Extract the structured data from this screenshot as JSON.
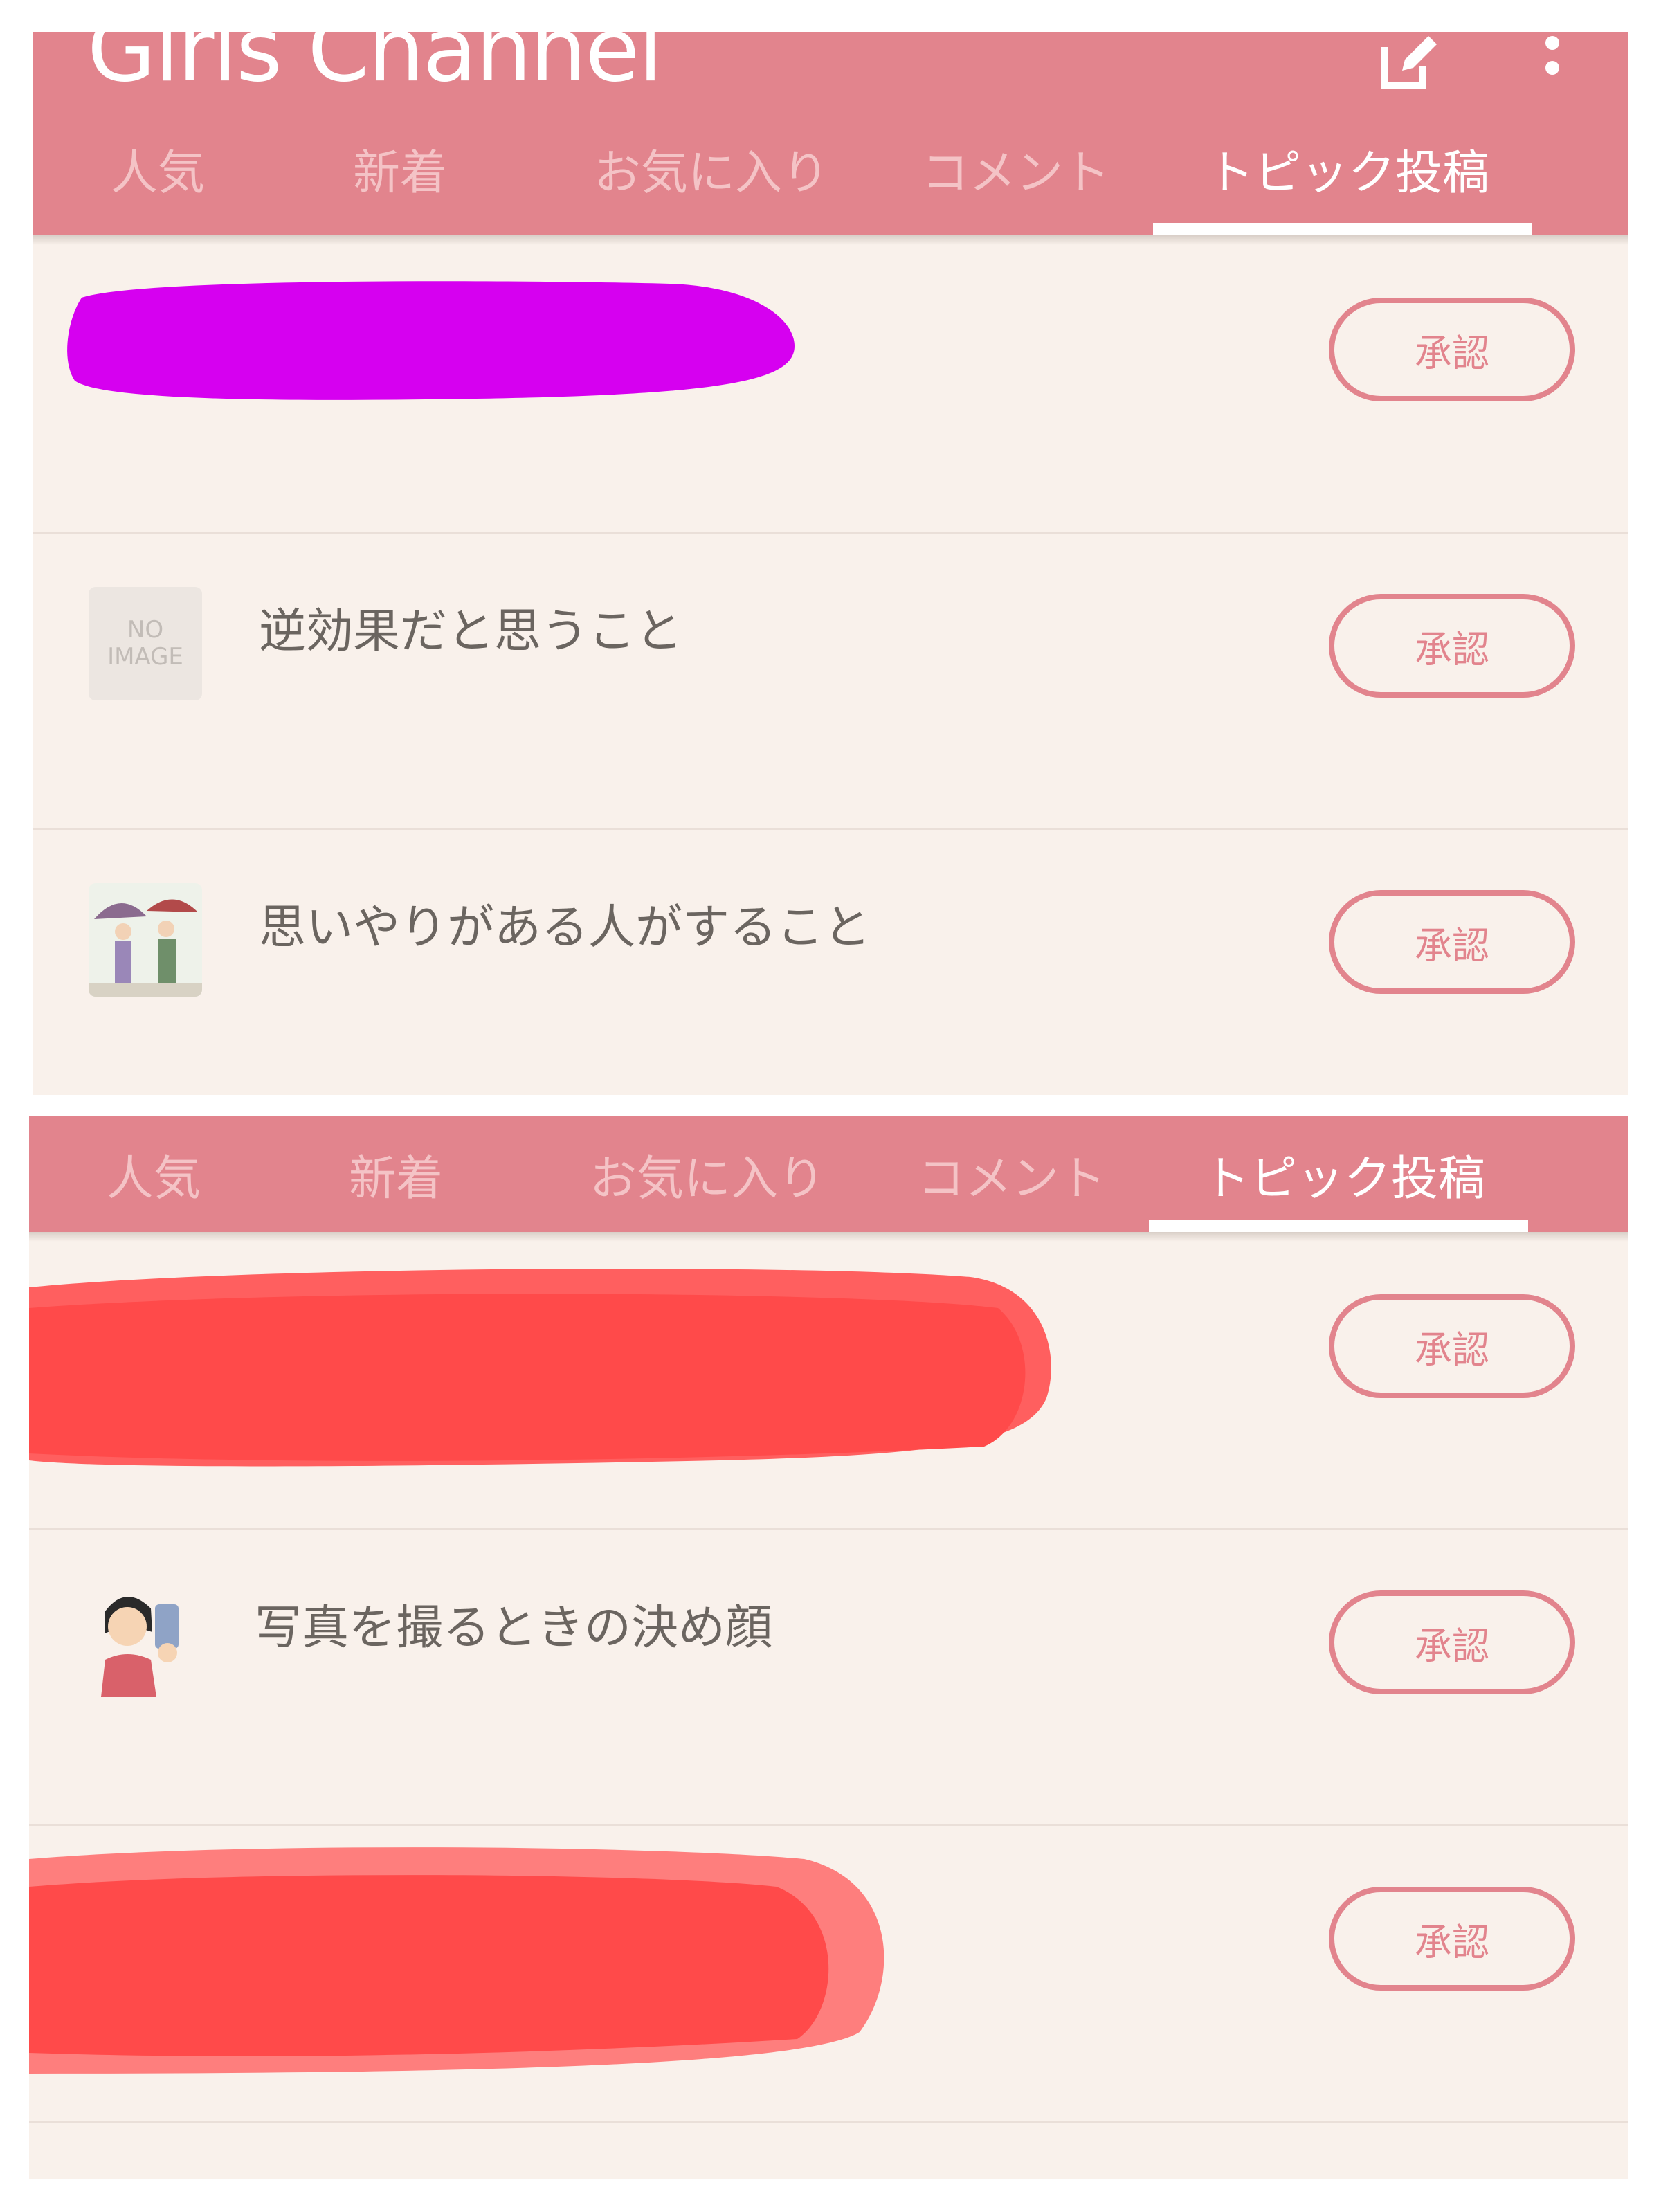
{
  "app": {
    "title": "Girls Channel"
  },
  "icons": {
    "compose": "compose-icon",
    "more": "more-vert-icon"
  },
  "tabs": [
    {
      "label": "人気",
      "active": false
    },
    {
      "label": "新着",
      "active": false
    },
    {
      "label": "お気に入り",
      "active": false
    },
    {
      "label": "コメント",
      "active": false
    },
    {
      "label": "トピック投稿",
      "active": true
    }
  ],
  "approve_label": "承認",
  "no_image": {
    "line1": "NO",
    "line2": "IMAGE"
  },
  "screen_top": {
    "rows": [
      {
        "title": "",
        "redacted": true
      },
      {
        "title": "逆効果だと思うこと",
        "thumb": "no-image"
      },
      {
        "title": "思いやりがある人がすること",
        "thumb": "couple-umbrella-image"
      }
    ]
  },
  "screen_bottom": {
    "rows": [
      {
        "title": "",
        "redacted": true
      },
      {
        "title": "写真を撮るときの決め顔",
        "thumb": "selfie-woman-image"
      },
      {
        "title": "",
        "redacted": true
      }
    ]
  },
  "colors": {
    "brand_pink": "#e2848d",
    "background": "#f9f1eb",
    "redact_magenta": "#d600f0",
    "redact_red": "#ff5252"
  }
}
